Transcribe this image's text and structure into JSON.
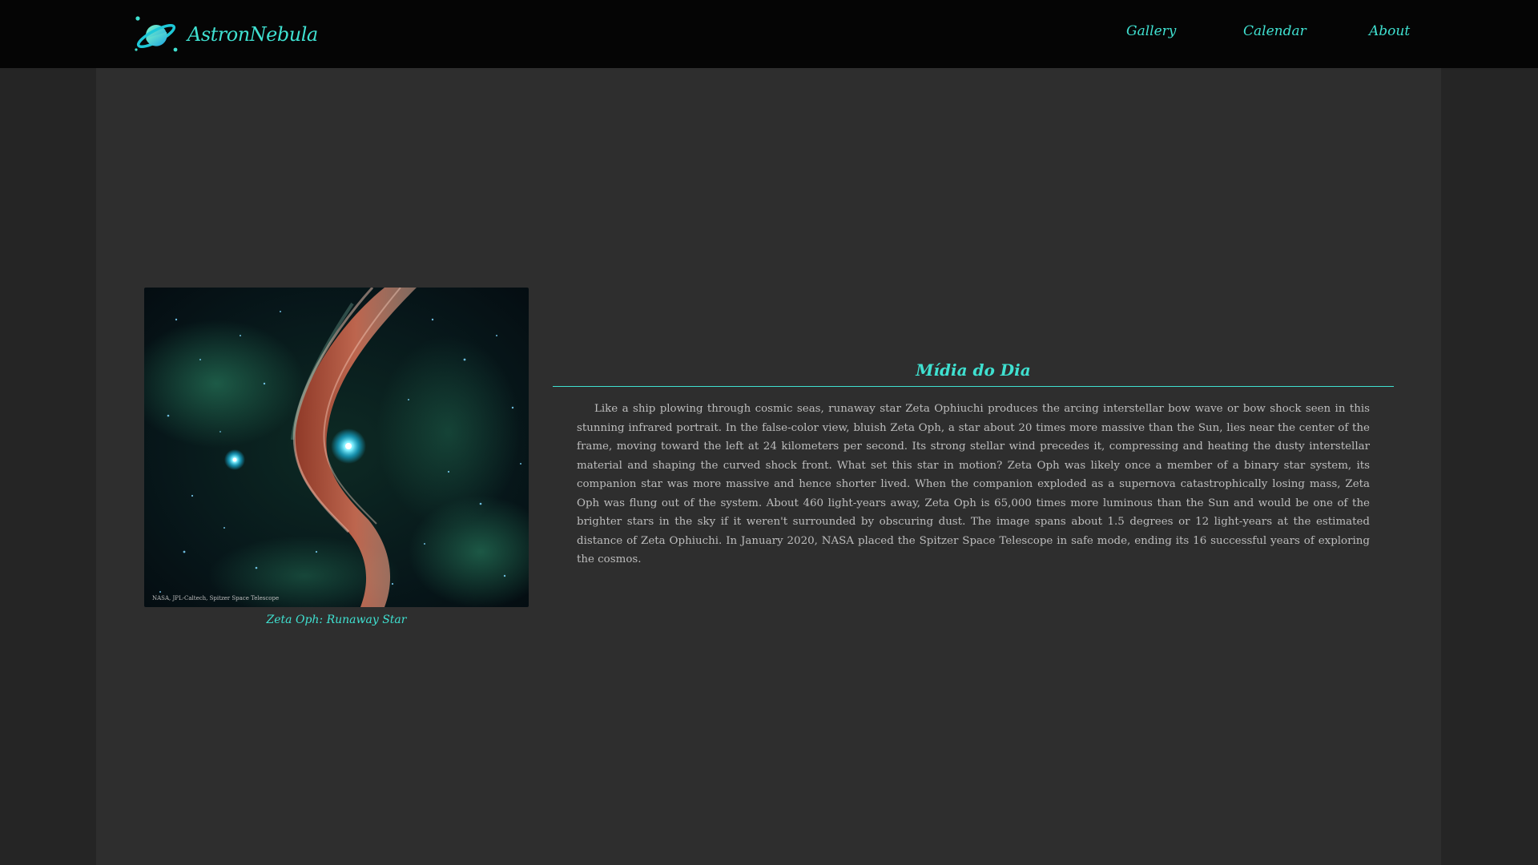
{
  "brand": {
    "name": "AstronNebula",
    "logo_icon": "planet-icon"
  },
  "nav": {
    "items": [
      {
        "label": "Gallery"
      },
      {
        "label": "Calendar"
      },
      {
        "label": "About"
      }
    ]
  },
  "media": {
    "image_icon": "nebula-image",
    "credit": "NASA, JPL-Caltech, Spitzer Space Telescope",
    "caption": "Zeta Oph: Runaway Star"
  },
  "section": {
    "title": "Mídia do Dia",
    "description": "Like a ship plowing through cosmic seas, runaway star Zeta Ophiuchi produces the arcing interstellar bow wave or bow shock seen in this stunning infrared portrait. In the false-color view, bluish Zeta Oph, a star about 20 times more massive than the Sun, lies near the center of the frame, moving toward the left at 24 kilometers per second. Its strong stellar wind precedes it, compressing and heating the dusty interstellar material and shaping the curved shock front. What set this star in motion? Zeta Oph was likely once a member of a binary star system, its companion star was more massive and hence shorter lived. When the companion exploded as a supernova catastrophically losing mass, Zeta Oph was flung out of the system. About 460 light-years away, Zeta Oph is 65,000 times more luminous than the Sun and would be one of the brighter stars in the sky if it weren't surrounded by obscuring dust. The image spans about 1.5 degrees or 12 light-years at the estimated distance of Zeta Ophiuchi. In January 2020, NASA placed the Spitzer Space Telescope in safe mode, ending its 16 successful years of exploring the cosmos."
  },
  "colors": {
    "accent": "#3fe0d0",
    "navbar_bg": "#050505",
    "page_bg": "#252525",
    "content_bg": "#2e2e2e",
    "body_text": "#bdbdbd"
  }
}
